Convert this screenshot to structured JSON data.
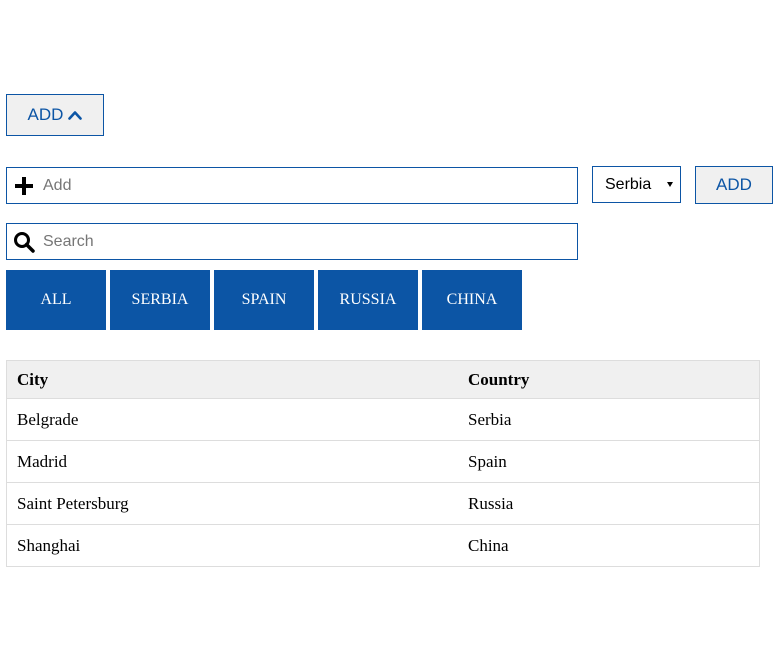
{
  "toggle": {
    "label": "ADD"
  },
  "add_form": {
    "placeholder": "Add",
    "value": "",
    "country_select": {
      "selected": "Serbia",
      "options": [
        "Serbia",
        "Spain",
        "Russia",
        "China"
      ]
    },
    "submit_label": "ADD"
  },
  "search": {
    "placeholder": "Search",
    "value": ""
  },
  "filters": [
    "ALL",
    "SERBIA",
    "SPAIN",
    "RUSSIA",
    "CHINA"
  ],
  "table": {
    "headers": {
      "city": "City",
      "country": "Country"
    },
    "rows": [
      {
        "city": "Belgrade",
        "country": "Serbia"
      },
      {
        "city": "Madrid",
        "country": "Spain"
      },
      {
        "city": "Saint Petersburg",
        "country": "Russia"
      },
      {
        "city": "Shanghai",
        "country": "China"
      }
    ]
  },
  "colors": {
    "accent": "#0c55a5",
    "button_bg": "#f0f0f0",
    "border": "#dddddd"
  },
  "icons": {
    "toggle": "chevron-up-icon",
    "add": "plus-icon",
    "search": "search-icon"
  }
}
